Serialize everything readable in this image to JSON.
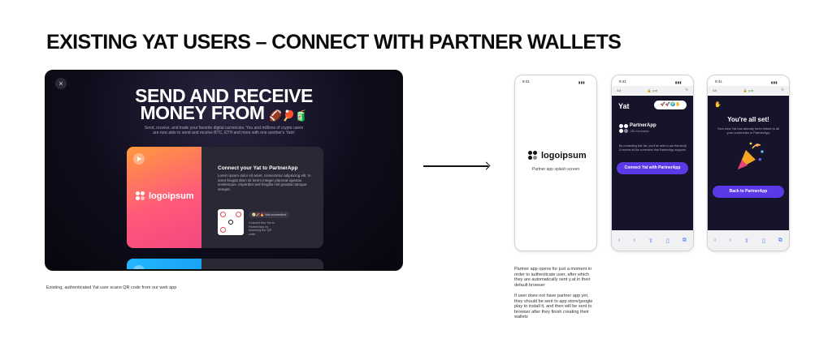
{
  "title": "EXISTING YAT USERS – CONNECT WITH PARTNER WALLETS",
  "web": {
    "close": "×",
    "hero_line1": "SEND AND RECEIVE",
    "hero_line2": "MONEY FROM",
    "hero_emojis": "🏈🏓🧃",
    "subtitle": "Send, receive, and trade your favorite digital currencies. You and millions of crypto users are now able to send and receive BTC, ETH and more with one another's Yats!",
    "card": {
      "logo": "logoipsum",
      "title": "Connect your Yat to PartnerApp",
      "body": "Lorem ipsum dolor sit amet, consectetur adipiscing elit. In amet feugiat diam sit lorem integer placerat egestas scelerisque. Imperdiet sed fringilla nisl gravida natoque semper.",
      "status_pill": "🧭🎉🔥 Not connected",
      "qr_caption": "Connect this Yat to PartnerApp by scanning the QR code"
    }
  },
  "caption": "Existing, authenticated Yat user scans QR code from our web app",
  "phones": {
    "splash": {
      "time": "9:41",
      "logo": "logoipsum",
      "label": "Partner app splash screen"
    },
    "connect": {
      "time": "9:41",
      "aa": "AA",
      "domain": "🔒 y.at",
      "yat": "Yat",
      "emojis": "🚀🚀🌍✋",
      "app_name": "PartnerApp",
      "app_sub": "136 Currencies",
      "info": "By connecting this Yat, you'll be able to use this emoji & receive all the currencies that PartnerApp supports",
      "cta": "Connect Yat with PartnerApp"
    },
    "success": {
      "time": "9:41",
      "aa": "AA",
      "domain": "🔒 y.at",
      "heading": "You're all set!",
      "desc": "Your new Yat has already been linked to all your currencies in PartnerApp",
      "cta": "Back to PartnerApp"
    }
  },
  "notes": {
    "note1": "Partner app opens for just a moment in order to authenticate user, after which they are automatically sent y.at in their default browser",
    "note2": "If user does not have partner app yet, they should be sent to app store/google play to install it, and then will be sent to browser after they finish creating their wallets"
  },
  "colors": {
    "accent": "#5b39e6",
    "dark_bg": "#16142a",
    "card_gradient_start": "#ff9a3d",
    "card_gradient_end": "#f2477f"
  }
}
